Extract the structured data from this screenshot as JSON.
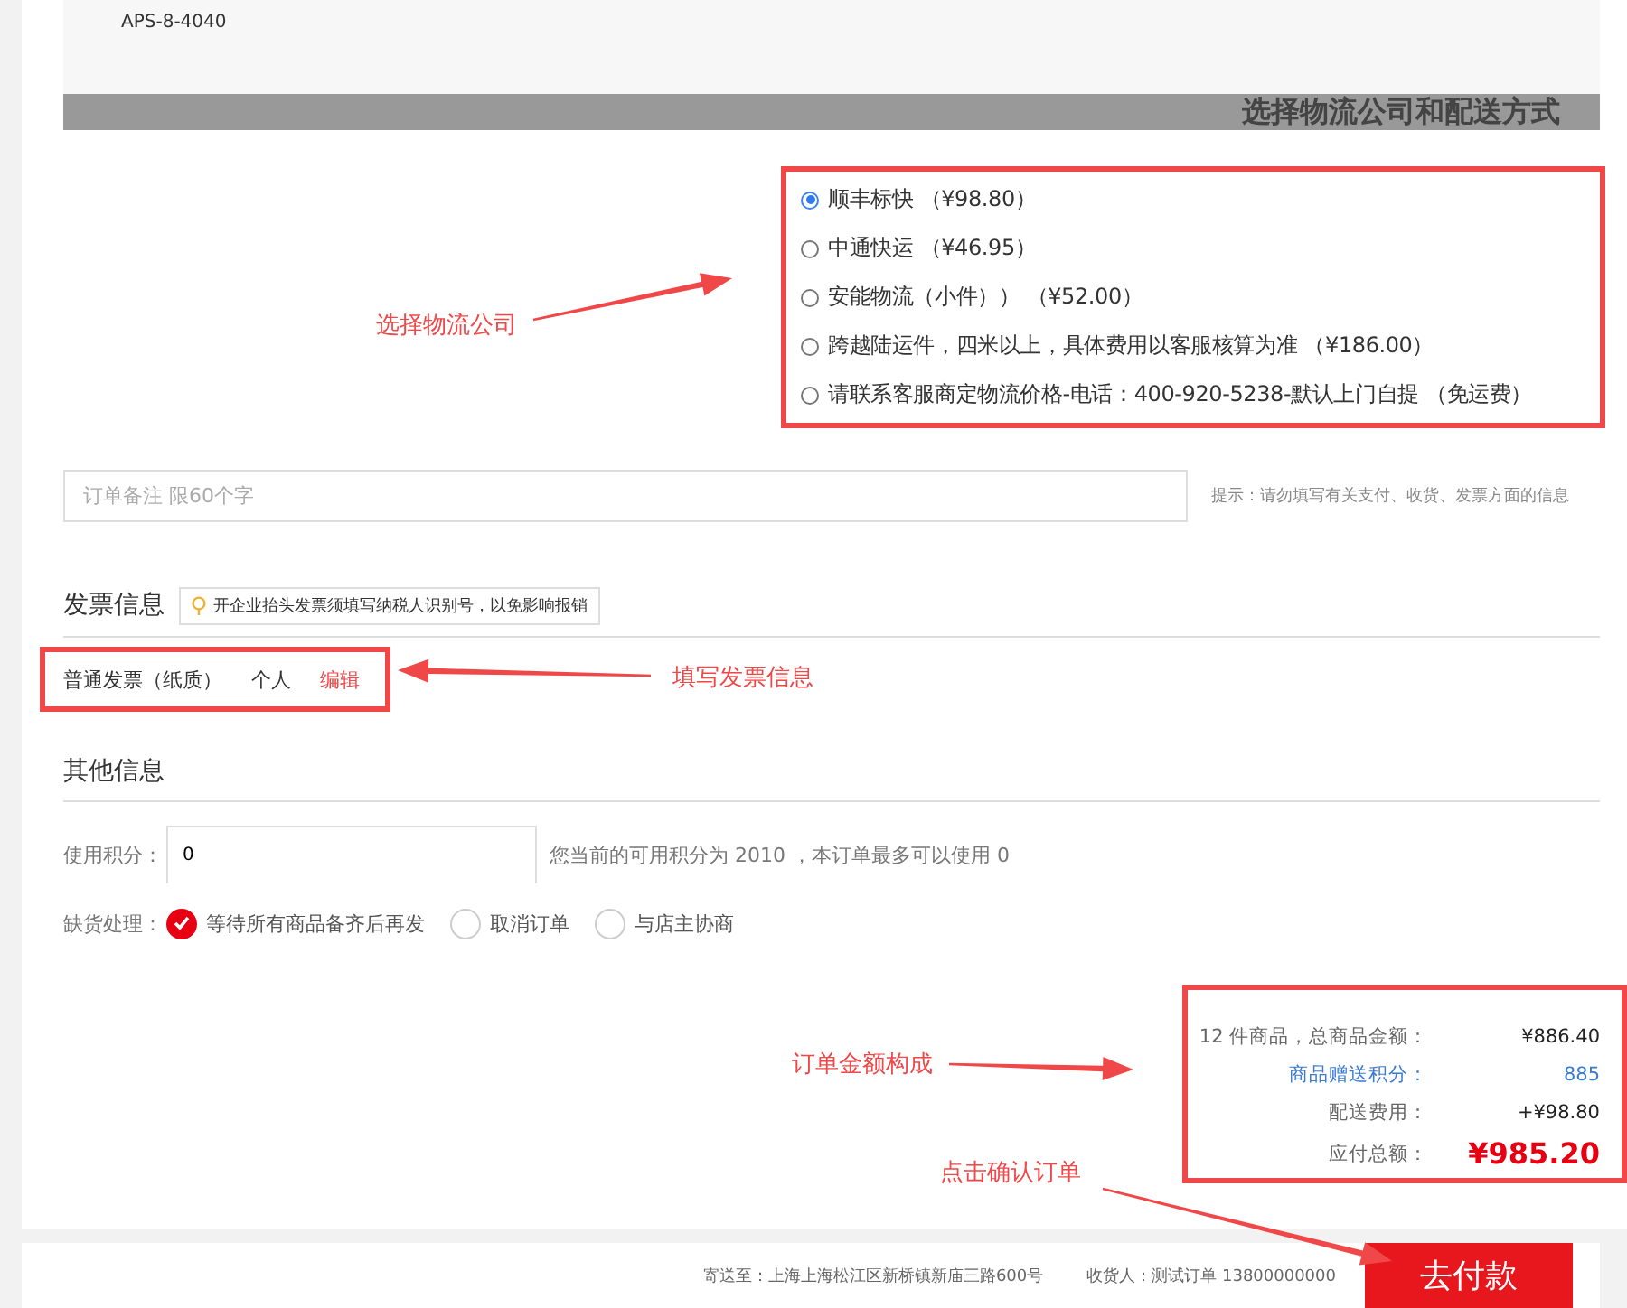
{
  "product_fragment": {
    "code": "APS-8-4040"
  },
  "shipping": {
    "heading": "选择物流公司和配送方式",
    "options": [
      {
        "label": "顺丰标快 （¥98.80）",
        "selected": true
      },
      {
        "label": "中通快运 （¥46.95）",
        "selected": false
      },
      {
        "label": "安能物流（小件）） （¥52.00）",
        "selected": false
      },
      {
        "label": "跨越陆运件，四米以上，具体费用以客服核算为准 （¥186.00）",
        "selected": false
      },
      {
        "label": "请联系客服商定物流价格-电话：400-920-5238-默认上门自提 （免运费）",
        "selected": false
      }
    ]
  },
  "remarks": {
    "placeholder": "订单备注 限60个字",
    "hint": "提示：请勿填写有关支付、收货、发票方面的信息"
  },
  "invoice": {
    "heading": "发票信息",
    "tip": "开企业抬头发票须填写纳税人识别号，以免影响报销",
    "type": "普通发票（纸质）",
    "title": "个人",
    "edit_link": "编辑"
  },
  "other": {
    "heading": "其他信息",
    "points": {
      "label": "使用积分：",
      "value": "0",
      "note": "您当前的可用积分为 2010 ，本订单最多可以使用 0"
    },
    "stockout": {
      "label": "缺货处理：",
      "options": [
        {
          "label": "等待所有商品备齐后再发",
          "selected": true
        },
        {
          "label": "取消订单",
          "selected": false
        },
        {
          "label": "与店主协商",
          "selected": false
        }
      ]
    }
  },
  "summary": {
    "rows": [
      {
        "kind": "normal",
        "label": "12 件商品，总商品金额：",
        "value": "¥886.40"
      },
      {
        "kind": "points",
        "label": "商品赠送积分：",
        "value": "885"
      },
      {
        "kind": "normal",
        "label": "配送费用：",
        "value": "+¥98.80"
      },
      {
        "kind": "total",
        "label": "应付总额：",
        "value": "¥985.20"
      }
    ]
  },
  "footer": {
    "address": "寄送至：上海上海松江区新桥镇新庙三路600号",
    "receiver": "收货人：测试订单  13800000000",
    "pay_button": "去付款"
  },
  "annotations": [
    {
      "text": "选择物流公司"
    },
    {
      "text": "填写发票信息"
    },
    {
      "text": "订单金额构成"
    },
    {
      "text": "点击确认订单"
    }
  ]
}
